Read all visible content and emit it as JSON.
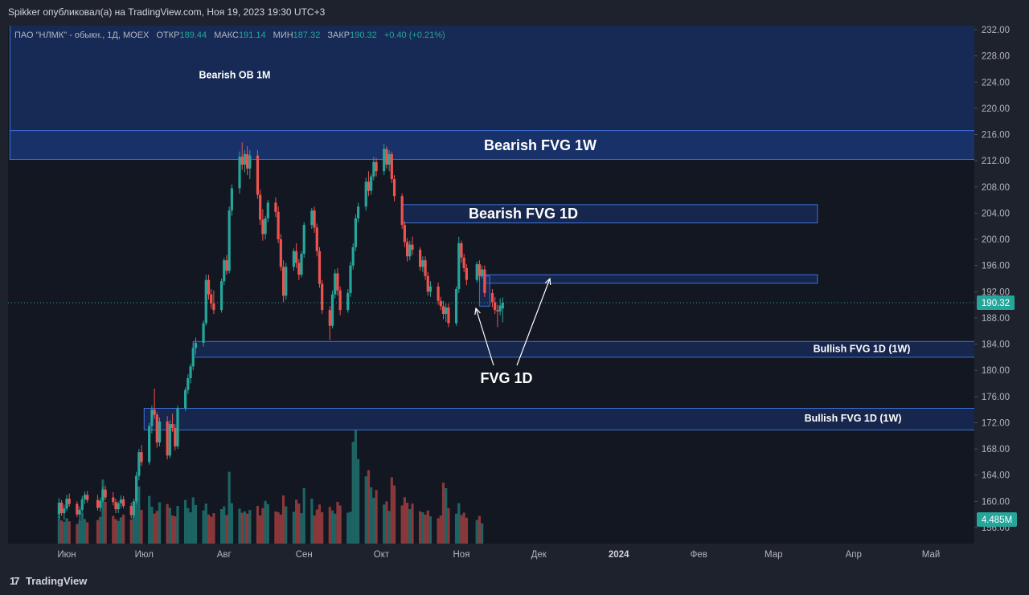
{
  "header": {
    "published_text": "Spikker опубликовал(а) на TradingView.com, Ноя 19, 2023 19:30 UTC+3"
  },
  "legend": {
    "symbol": "ПАО \"НЛМК\" - обыкн., 1Д, MOEX",
    "open_label": "ОТКР",
    "open_value": "189.44",
    "high_label": "МАКС",
    "high_value": "191.14",
    "low_label": "МИН",
    "low_value": "187.32",
    "close_label": "ЗАКР",
    "close_value": "190.32",
    "change": "+0.40 (+0.21%)"
  },
  "footer": {
    "brand": "TradingView"
  },
  "colors": {
    "up": "#26a69a",
    "down": "#ef5350",
    "zone_fill": "#1b3a80",
    "zone_stroke": "#3d72d8",
    "price_badge": "#26a69a",
    "background": "#131722"
  },
  "chart_data": {
    "type": "candlestick",
    "y_axis": {
      "ticks": [
        232,
        228,
        224,
        220,
        216,
        212,
        208,
        204,
        200,
        196,
        192,
        188,
        184,
        180,
        176,
        172,
        168,
        164,
        160,
        156
      ],
      "tick_labels": [
        "232.00",
        "228.00",
        "224.00",
        "220.00",
        "216.00",
        "212.00",
        "208.00",
        "204.00",
        "200.00",
        "196.00",
        "192.00",
        "188.00",
        "184.00",
        "180.00",
        "176.00",
        "172.00",
        "168.00",
        "164.00",
        "160.00",
        "156.00"
      ],
      "ylim": [
        154.8,
        233.8
      ]
    },
    "x_axis": {
      "tick_labels": [
        "Июн",
        "Июл",
        "Авг",
        "Сен",
        "Окт",
        "Ноя",
        "Дек",
        "2024",
        "Фев",
        "Мар",
        "Апр",
        "Май"
      ],
      "tick_dates": [
        "2023-06-01",
        "2023-07-01",
        "2023-08-01",
        "2023-09-01",
        "2023-10-01",
        "2023-11-01",
        "2023-12-01",
        "2024-01-01",
        "2024-02-01",
        "2024-03-01",
        "2024-04-01",
        "2024-05-01"
      ]
    },
    "last_price": {
      "value": 190.32,
      "label": "190.32"
    },
    "volume_label": "4.485M",
    "zones": [
      {
        "label": "Bearish OB 1M",
        "from_date": "2023-05-10",
        "to_date": "2024-05-31",
        "top": 236.0,
        "bottom": 212.2
      },
      {
        "label": "Bearish FVG 1W",
        "from_date": "2023-05-10",
        "to_date": "2024-05-31",
        "top": 216.6,
        "bottom": 212.2
      },
      {
        "label": "Bearish FVG 1D",
        "from_date": "2023-10-09",
        "to_date": "2024-03-18",
        "top": 205.3,
        "bottom": 202.5
      },
      {
        "label": "",
        "from_date": "2023-11-10",
        "to_date": "2024-03-18",
        "top": 194.6,
        "bottom": 193.3
      },
      {
        "label": "",
        "from_date": "2023-11-08",
        "to_date": "2023-11-12",
        "top": 194.4,
        "bottom": 189.8
      },
      {
        "label": "Bullish FVG 1D (1W)",
        "from_date": "2023-07-20",
        "to_date": "2024-05-31",
        "top": 184.4,
        "bottom": 182.0
      },
      {
        "label": "Bullish FVG 1D (1W)",
        "from_date": "2023-07-01",
        "to_date": "2024-05-31",
        "top": 174.2,
        "bottom": 170.9
      }
    ],
    "annotation": {
      "text": "FVG 1D"
    },
    "candles": [
      [
        "2023-05-29",
        158.0,
        160.5,
        157.5,
        159.8
      ],
      [
        "2023-05-30",
        159.8,
        160.2,
        157.8,
        158.2
      ],
      [
        "2023-05-31",
        158.2,
        159.5,
        157.2,
        158.9
      ],
      [
        "2023-06-01",
        158.9,
        161.0,
        158.5,
        160.4
      ],
      [
        "2023-06-02",
        160.4,
        161.2,
        159.2,
        159.6
      ],
      [
        "2023-06-05",
        159.6,
        160.0,
        157.6,
        158.0
      ],
      [
        "2023-06-06",
        158.0,
        159.2,
        157.0,
        158.7
      ],
      [
        "2023-06-07",
        158.7,
        160.8,
        158.3,
        160.3
      ],
      [
        "2023-06-08",
        160.3,
        161.5,
        159.6,
        161.0
      ],
      [
        "2023-06-09",
        161.0,
        161.6,
        159.8,
        160.2
      ],
      [
        "2023-06-13",
        160.2,
        161.0,
        158.6,
        159.0
      ],
      [
        "2023-06-14",
        159.0,
        160.6,
        158.4,
        160.1
      ],
      [
        "2023-06-15",
        160.1,
        162.2,
        159.8,
        161.8
      ],
      [
        "2023-06-16",
        161.8,
        162.4,
        160.2,
        160.6
      ],
      [
        "2023-06-19",
        160.6,
        161.4,
        159.4,
        159.9
      ],
      [
        "2023-06-20",
        159.9,
        160.4,
        158.2,
        158.8
      ],
      [
        "2023-06-21",
        158.8,
        160.0,
        158.2,
        159.7
      ],
      [
        "2023-06-22",
        159.7,
        160.9,
        159.0,
        160.3
      ],
      [
        "2023-06-23",
        160.3,
        160.8,
        158.9,
        159.3
      ],
      [
        "2023-06-26",
        159.3,
        159.8,
        157.4,
        157.9
      ],
      [
        "2023-06-27",
        157.9,
        160.4,
        157.5,
        160.0
      ],
      [
        "2023-06-28",
        160.0,
        164.5,
        159.6,
        163.9
      ],
      [
        "2023-06-29",
        163.9,
        168.0,
        163.2,
        167.5
      ],
      [
        "2023-06-30",
        167.5,
        168.6,
        165.4,
        166.0
      ],
      [
        "2023-07-03",
        166.0,
        172.0,
        165.6,
        171.5
      ],
      [
        "2023-07-04",
        171.5,
        174.6,
        170.4,
        174.0
      ],
      [
        "2023-07-05",
        174.0,
        177.2,
        172.6,
        173.2
      ],
      [
        "2023-07-06",
        173.2,
        173.6,
        168.2,
        169.0
      ],
      [
        "2023-07-07",
        169.0,
        172.8,
        168.4,
        172.2
      ],
      [
        "2023-07-10",
        172.2,
        173.0,
        166.4,
        167.0
      ],
      [
        "2023-07-11",
        167.0,
        172.4,
        166.6,
        171.8
      ],
      [
        "2023-07-12",
        171.8,
        173.4,
        170.6,
        171.2
      ],
      [
        "2023-07-13",
        171.2,
        171.8,
        167.8,
        168.4
      ],
      [
        "2023-07-14",
        168.4,
        174.6,
        168.0,
        174.2
      ],
      [
        "2023-07-17",
        174.2,
        177.4,
        173.8,
        177.0
      ],
      [
        "2023-07-18",
        177.0,
        179.4,
        176.4,
        178.8
      ],
      [
        "2023-07-19",
        178.8,
        181.0,
        178.0,
        180.6
      ],
      [
        "2023-07-20",
        180.6,
        184.2,
        180.0,
        183.4
      ],
      [
        "2023-07-21",
        183.4,
        185.0,
        182.4,
        184.2
      ],
      [
        "2023-07-24",
        184.2,
        187.6,
        183.6,
        187.2
      ],
      [
        "2023-07-25",
        187.2,
        194.6,
        186.8,
        193.8
      ],
      [
        "2023-07-26",
        193.8,
        194.6,
        190.8,
        191.6
      ],
      [
        "2023-07-27",
        191.6,
        192.4,
        189.4,
        190.2
      ],
      [
        "2023-07-28",
        190.2,
        192.2,
        188.6,
        189.2
      ],
      [
        "2023-07-31",
        189.2,
        194.0,
        188.8,
        193.6
      ],
      [
        "2023-08-01",
        193.6,
        197.2,
        193.0,
        196.8
      ],
      [
        "2023-08-02",
        196.8,
        197.6,
        194.6,
        195.2
      ],
      [
        "2023-08-03",
        195.2,
        205.0,
        194.8,
        204.4
      ],
      [
        "2023-08-04",
        204.4,
        208.4,
        203.6,
        207.8
      ],
      [
        "2023-08-07",
        207.8,
        213.4,
        207.0,
        212.6
      ],
      [
        "2023-08-08",
        212.6,
        214.8,
        210.6,
        211.4
      ],
      [
        "2023-08-09",
        211.4,
        213.6,
        210.2,
        213.0
      ],
      [
        "2023-08-10",
        213.0,
        214.2,
        209.8,
        210.8
      ],
      [
        "2023-08-11",
        210.8,
        213.6,
        209.2,
        212.8
      ],
      [
        "2023-08-14",
        212.8,
        213.6,
        206.2,
        206.8
      ],
      [
        "2023-08-15",
        206.8,
        207.6,
        202.2,
        203.0
      ],
      [
        "2023-08-16",
        203.0,
        204.6,
        199.8,
        200.8
      ],
      [
        "2023-08-17",
        200.8,
        203.6,
        200.0,
        203.2
      ],
      [
        "2023-08-18",
        203.2,
        206.0,
        202.6,
        205.6
      ],
      [
        "2023-08-21",
        205.6,
        206.4,
        203.4,
        204.2
      ],
      [
        "2023-08-22",
        204.2,
        205.0,
        199.4,
        200.0
      ],
      [
        "2023-08-23",
        200.0,
        200.8,
        195.2,
        195.8
      ],
      [
        "2023-08-24",
        195.8,
        196.8,
        190.4,
        191.4
      ],
      [
        "2023-08-25",
        191.4,
        196.4,
        190.8,
        195.8
      ],
      [
        "2023-08-28",
        195.8,
        198.6,
        195.2,
        198.2
      ],
      [
        "2023-08-29",
        198.2,
        199.4,
        195.6,
        196.4
      ],
      [
        "2023-08-30",
        196.4,
        197.0,
        193.8,
        194.6
      ],
      [
        "2023-08-31",
        194.6,
        198.2,
        194.2,
        197.8
      ],
      [
        "2023-09-01",
        197.8,
        202.6,
        197.2,
        202.2
      ],
      [
        "2023-09-04",
        202.2,
        204.8,
        201.6,
        204.4
      ],
      [
        "2023-09-05",
        204.4,
        205.0,
        201.0,
        201.8
      ],
      [
        "2023-09-06",
        201.8,
        202.4,
        197.4,
        198.2
      ],
      [
        "2023-09-07",
        198.2,
        198.8,
        192.6,
        193.2
      ],
      [
        "2023-09-08",
        193.2,
        193.8,
        188.6,
        189.2
      ],
      [
        "2023-09-11",
        189.2,
        189.8,
        184.6,
        186.8
      ],
      [
        "2023-09-12",
        186.8,
        192.2,
        186.4,
        191.6
      ],
      [
        "2023-09-13",
        191.6,
        195.4,
        191.0,
        194.8
      ],
      [
        "2023-09-14",
        194.8,
        195.6,
        191.4,
        192.2
      ],
      [
        "2023-09-15",
        192.2,
        192.8,
        188.4,
        189.2
      ],
      [
        "2023-09-18",
        189.2,
        192.4,
        188.8,
        191.8
      ],
      [
        "2023-09-19",
        191.8,
        196.6,
        191.2,
        196.0
      ],
      [
        "2023-09-20",
        196.0,
        199.4,
        195.4,
        198.8
      ],
      [
        "2023-09-21",
        198.8,
        203.8,
        198.2,
        203.2
      ],
      [
        "2023-09-22",
        203.2,
        205.6,
        202.6,
        205.0
      ],
      [
        "2023-09-25",
        205.0,
        209.4,
        204.4,
        208.8
      ],
      [
        "2023-09-26",
        208.8,
        210.4,
        206.6,
        207.4
      ],
      [
        "2023-09-27",
        207.4,
        210.0,
        206.8,
        209.6
      ],
      [
        "2023-09-28",
        209.6,
        212.6,
        209.0,
        211.8
      ],
      [
        "2023-09-29",
        211.8,
        212.4,
        209.6,
        210.4
      ],
      [
        "2023-10-02",
        210.4,
        214.6,
        209.8,
        213.8
      ],
      [
        "2023-10-03",
        213.8,
        214.2,
        210.8,
        211.4
      ],
      [
        "2023-10-04",
        211.4,
        213.6,
        210.4,
        213.0
      ],
      [
        "2023-10-05",
        213.0,
        213.4,
        208.6,
        209.2
      ],
      [
        "2023-10-06",
        209.2,
        209.8,
        205.8,
        206.6
      ],
      [
        "2023-10-09",
        206.6,
        207.0,
        201.6,
        202.2
      ],
      [
        "2023-10-10",
        202.2,
        202.8,
        198.8,
        199.6
      ],
      [
        "2023-10-11",
        199.6,
        200.2,
        196.6,
        197.4
      ],
      [
        "2023-10-12",
        197.4,
        199.8,
        196.8,
        199.2
      ],
      [
        "2023-10-13",
        199.2,
        200.4,
        197.6,
        198.4
      ],
      [
        "2023-10-16",
        198.4,
        198.8,
        195.2,
        195.8
      ],
      [
        "2023-10-17",
        195.8,
        197.4,
        195.0,
        196.8
      ],
      [
        "2023-10-18",
        196.8,
        197.4,
        193.8,
        194.4
      ],
      [
        "2023-10-19",
        194.4,
        195.0,
        191.4,
        192.0
      ],
      [
        "2023-10-20",
        192.0,
        193.6,
        191.2,
        192.8
      ],
      [
        "2023-10-23",
        192.8,
        193.4,
        190.0,
        190.6
      ],
      [
        "2023-10-24",
        190.6,
        191.2,
        189.2,
        189.8
      ],
      [
        "2023-10-25",
        189.8,
        190.6,
        187.8,
        188.6
      ],
      [
        "2023-10-26",
        188.6,
        190.2,
        187.4,
        189.6
      ],
      [
        "2023-10-27",
        189.6,
        190.2,
        186.6,
        187.2
      ],
      [
        "2023-10-30",
        187.2,
        192.8,
        186.8,
        192.4
      ],
      [
        "2023-10-31",
        192.4,
        200.4,
        191.8,
        199.4
      ],
      [
        "2023-11-01",
        199.4,
        199.8,
        196.4,
        197.2
      ],
      [
        "2023-11-02",
        197.2,
        197.8,
        195.0,
        195.6
      ],
      [
        "2023-11-03",
        195.6,
        196.2,
        193.0,
        193.8
      ],
      [
        "2023-11-07",
        193.8,
        196.6,
        193.4,
        196.2
      ],
      [
        "2023-11-08",
        196.2,
        196.8,
        193.6,
        194.4
      ],
      [
        "2023-11-09",
        194.4,
        196.0,
        194.0,
        195.4
      ],
      [
        "2023-11-10",
        195.4,
        196.0,
        191.2,
        191.8
      ],
      [
        "2023-11-13",
        191.8,
        192.4,
        189.6,
        190.4
      ],
      [
        "2023-11-14",
        190.4,
        191.2,
        188.6,
        189.2
      ],
      [
        "2023-11-15",
        189.2,
        190.0,
        186.6,
        189.0
      ],
      [
        "2023-11-16",
        189.0,
        191.0,
        188.4,
        189.9
      ],
      [
        "2023-11-17",
        189.44,
        191.14,
        187.32,
        190.32
      ]
    ],
    "volumes": [
      6.2,
      5.1,
      4.8,
      5.6,
      4.9,
      4.3,
      5.0,
      6.8,
      5.4,
      4.7,
      5.2,
      5.9,
      14.1,
      9.2,
      6.1,
      5.4,
      5.0,
      5.8,
      6.4,
      5.3,
      7.1,
      9.8,
      12.6,
      7.4,
      10.5,
      8.1,
      6.6,
      7.2,
      9.1,
      8.7,
      7.9,
      6.2,
      6.0,
      8.3,
      9.6,
      7.8,
      6.9,
      10.2,
      8.5,
      7.3,
      8.8,
      6.4,
      5.9,
      6.7,
      7.6,
      8.2,
      6.3,
      15.8,
      8.9,
      7.7,
      6.8,
      7.1,
      6.6,
      7.4,
      8.3,
      6.2,
      7.8,
      9.4,
      8.7,
      7.1,
      6.9,
      6.4,
      10.6,
      8.2,
      7.0,
      9.7,
      8.8,
      6.7,
      12.2,
      9.9,
      6.2,
      7.5,
      8.6,
      6.9,
      8.1,
      7.3,
      6.6,
      9.2,
      8.4,
      6.8,
      7.0,
      22.4,
      25.1,
      18.6,
      14.8,
      16.2,
      12.4,
      10.1,
      11.8,
      8.6,
      9.3,
      7.2,
      14.6,
      12.8,
      8.4,
      10.2,
      9.0,
      7.6,
      8.8,
      7.1,
      6.9,
      6.4,
      7.3,
      6.0,
      5.6,
      6.2,
      13.4,
      12.2,
      7.8,
      6.6,
      8.9,
      6.3,
      6.8,
      5.7,
      5.2,
      6.1,
      4.485
    ]
  }
}
